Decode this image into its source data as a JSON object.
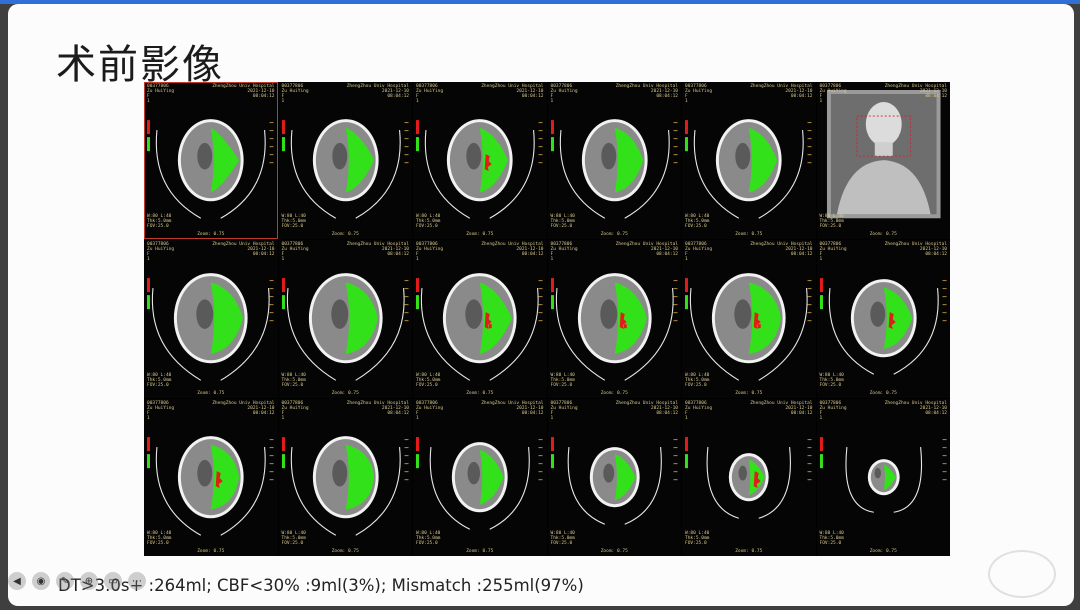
{
  "slide": {
    "title": "术前影像",
    "caption": "DT>3.0s+ :264ml;  CBF<30% :9ml(3%);  Mismatch :255ml(97%)"
  },
  "viewer": {
    "overlay_top_left": "00377806\nZu HuiYing\nF\n1",
    "overlay_top_right": "ZhengZhou Univ Hospital\n2021-12-10\n08:04:12",
    "overlay_bottom_left": "W:80 L:40\nThk:5.0mm\nFOV:25.0",
    "overlay_bottom_center": "Zoom: 0.75",
    "colors": {
      "background": "#000000",
      "hypoperfusion": "#33e11a",
      "core": "#e21b1b",
      "skull": "#f2f2f2",
      "brain": "#8a8a8a"
    }
  },
  "controls": {
    "icons": [
      "prev-icon",
      "pointer-icon",
      "pen-icon",
      "zoom-icon",
      "menu-icon",
      "more-icon"
    ],
    "glyphs": [
      "◀",
      "◉",
      "✎",
      "⊕",
      "▭",
      "⋯"
    ]
  }
}
